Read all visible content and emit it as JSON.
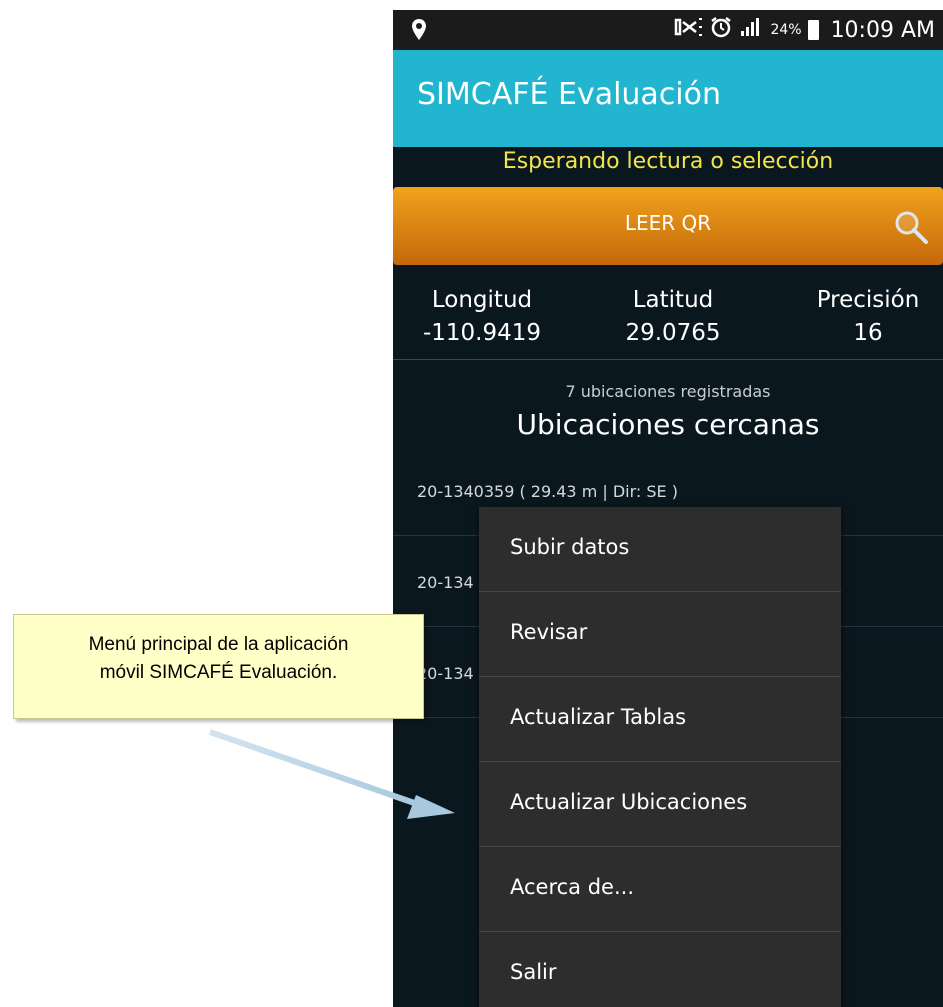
{
  "status_bar": {
    "signal_text": ".ıl",
    "battery_percent": "24%",
    "time": "10:09 AM",
    "icons": [
      "location-pin-icon",
      "nfc-icon",
      "alarm-icon",
      "signal-icon",
      "battery-icon"
    ]
  },
  "app_bar": {
    "title": "SIMCAFÉ Evaluación",
    "color": "#21b5cf"
  },
  "status_message": "Esperando lectura o selección",
  "qr_button": {
    "label": "LEER QR",
    "icon": "search-icon"
  },
  "coordinates": {
    "longitude_label": "Longitud",
    "longitude_value": "-110.9419",
    "latitude_label": "Latitud",
    "latitude_value": "29.0765",
    "precision_label": "Precisión",
    "precision_value": "16"
  },
  "locations": {
    "count_text": "7 ubicaciones registradas",
    "title": "Ubicaciones cercanas",
    "items": [
      "20-1340359 ( 29.43 m | Dir: SE )",
      "20-134",
      "20-134"
    ]
  },
  "menu": {
    "items": [
      "Subir datos",
      "Revisar",
      "Actualizar Tablas",
      "Actualizar Ubicaciones",
      "Acerca de...",
      "Salir"
    ]
  },
  "annotation": {
    "line1": "Menú principal de la aplicación",
    "line2": "móvil SIMCAFÉ Evaluación."
  }
}
